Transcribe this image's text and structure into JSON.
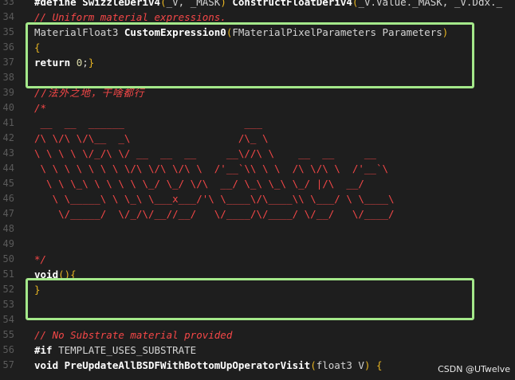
{
  "editor": {
    "lines": [
      {
        "n": "33",
        "segs": [
          [
            "kw",
            "#define "
          ],
          [
            "fn",
            "SwizzleDeriv4"
          ],
          [
            "paren",
            "("
          ],
          [
            "id",
            "_V, _MASK"
          ],
          [
            "paren",
            ")"
          ],
          [
            "fn",
            " ConstructFloatDeriv4"
          ],
          [
            "paren",
            "("
          ],
          [
            "id",
            "_V.Value._MASK, _V.Ddx._"
          ]
        ]
      },
      {
        "n": "34",
        "segs": [
          [
            "cm",
            "// Uniform material expressions."
          ]
        ]
      },
      {
        "n": "35",
        "segs": [
          [
            "ty",
            "MaterialFloat3 "
          ],
          [
            "fn",
            "CustomExpression0"
          ],
          [
            "paren",
            "("
          ],
          [
            "ty",
            "FMaterialPixelParameters Parameters"
          ],
          [
            "paren",
            ")"
          ]
        ]
      },
      {
        "n": "36",
        "segs": [
          [
            "brace",
            "{"
          ]
        ]
      },
      {
        "n": "37",
        "segs": [
          [
            "kw",
            "return "
          ],
          [
            "num",
            "0"
          ],
          [
            "punc",
            ";"
          ],
          [
            "brace",
            "}"
          ]
        ]
      },
      {
        "n": "38",
        "segs": []
      },
      {
        "n": "39",
        "segs": [
          [
            "cm-zh",
            "//法外之地，干啥都行"
          ]
        ]
      },
      {
        "n": "40",
        "segs": [
          [
            "cm",
            "/*"
          ]
        ]
      },
      {
        "n": "41",
        "segs": [
          [
            "ascii",
            " __  __  ______                    ___"
          ]
        ]
      },
      {
        "n": "42",
        "segs": [
          [
            "ascii",
            "/\\ \\/\\ \\/\\__  _\\                  /\\_ \\"
          ]
        ]
      },
      {
        "n": "43",
        "segs": [
          [
            "ascii",
            "\\ \\ \\ \\ \\/_/\\ \\/ __  __  __     __\\//\\ \\    __  __     __"
          ]
        ]
      },
      {
        "n": "44",
        "segs": [
          [
            "ascii",
            " \\ \\ \\ \\ \\ \\ \\ \\/\\ \\/\\ \\/\\ \\  /'__`\\\\ \\ \\  /\\ \\/\\ \\  /'__`\\"
          ]
        ]
      },
      {
        "n": "45",
        "segs": [
          [
            "ascii",
            "  \\ \\ \\_\\ \\ \\ \\ \\ \\_/ \\_/ \\/\\  __/ \\_\\ \\_\\ \\_/ |/\\  __/"
          ]
        ]
      },
      {
        "n": "46",
        "segs": [
          [
            "ascii",
            "   \\ \\_____\\ \\ \\_\\ \\___x___/'\\ \\____\\/\\____\\\\ \\___/ \\ \\____\\"
          ]
        ]
      },
      {
        "n": "47",
        "segs": [
          [
            "ascii",
            "    \\/_____/  \\/_/\\/__//__/   \\/____/\\/____/ \\/__/   \\/____/"
          ]
        ]
      },
      {
        "n": "48",
        "segs": []
      },
      {
        "n": "49",
        "segs": []
      },
      {
        "n": "50",
        "segs": [
          [
            "cm",
            "*/"
          ]
        ]
      },
      {
        "n": "51",
        "segs": [
          [
            "kw",
            "void"
          ],
          [
            "paren",
            "()"
          ],
          [
            "brace",
            "{"
          ]
        ]
      },
      {
        "n": "52",
        "segs": [
          [
            "brace",
            "}"
          ]
        ]
      },
      {
        "n": "53",
        "segs": []
      },
      {
        "n": "54",
        "segs": []
      },
      {
        "n": "55",
        "segs": [
          [
            "cm",
            "// No Substrate material provided"
          ]
        ]
      },
      {
        "n": "56",
        "segs": [
          [
            "kw",
            "#if "
          ],
          [
            "id",
            "TEMPLATE_USES_SUBSTRATE"
          ]
        ]
      },
      {
        "n": "57",
        "segs": [
          [
            "kw",
            "void "
          ],
          [
            "fn",
            "PreUpdateAllBSDFWithBottomUpOperatorVisit"
          ],
          [
            "paren",
            "("
          ],
          [
            "ty",
            "float3 V"
          ],
          [
            "paren",
            ")"
          ],
          [
            "brace",
            " {"
          ]
        ]
      }
    ]
  },
  "highlight_color": "#a4e88a",
  "watermark": "CSDN @UTwelve"
}
